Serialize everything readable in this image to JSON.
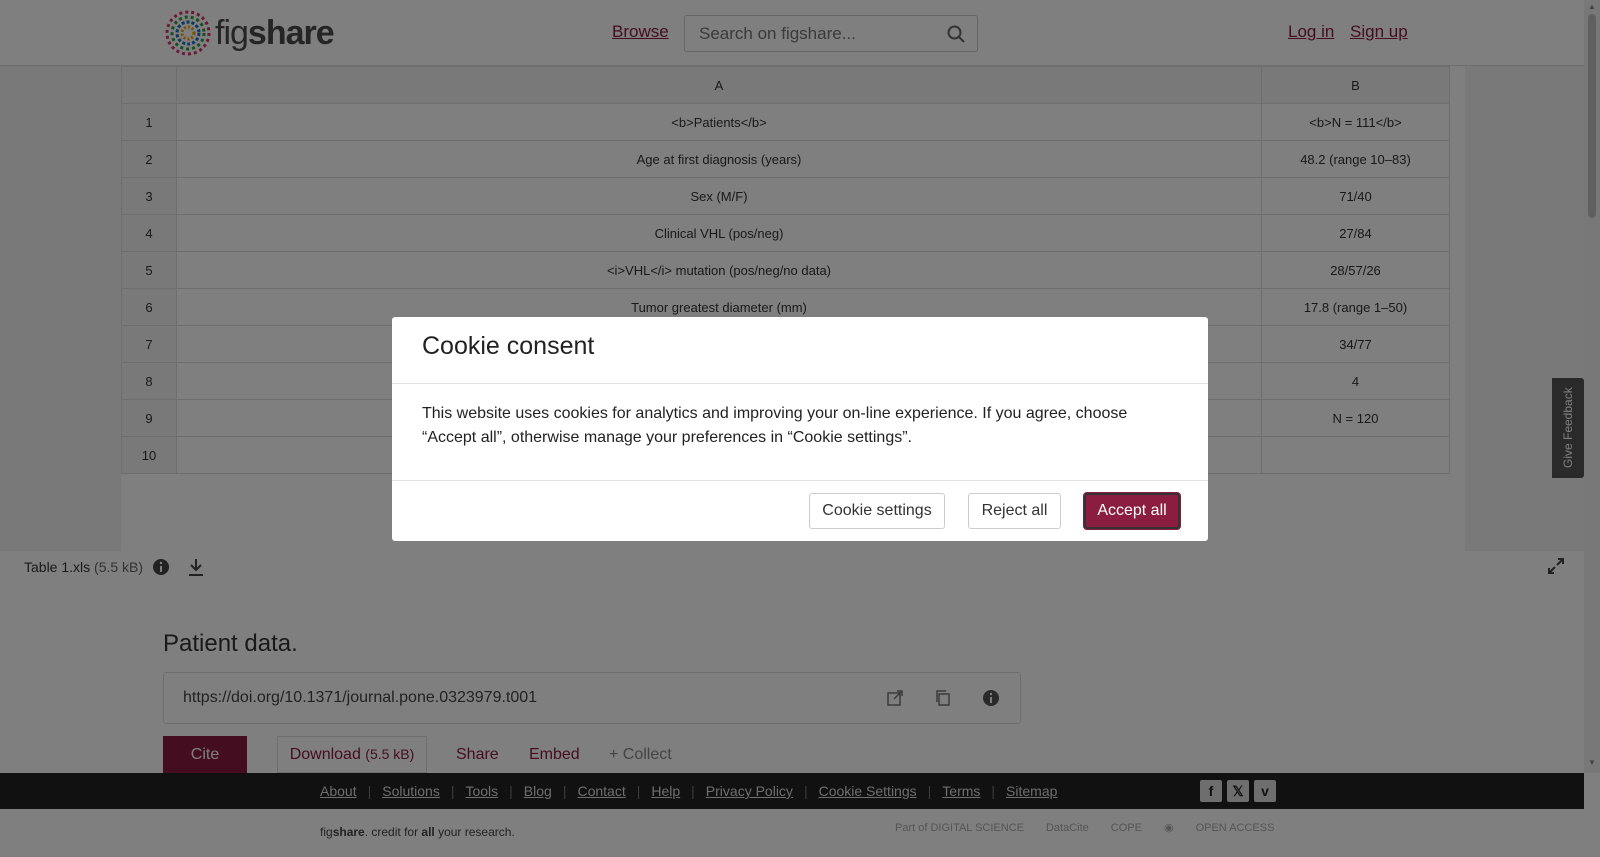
{
  "header": {
    "logo_text_light": "fig",
    "logo_text_bold": "share",
    "browse_label": "Browse",
    "search_placeholder": "Search on figshare...",
    "login_label": "Log in",
    "signup_label": "Sign up"
  },
  "sheet": {
    "columns": [
      "A",
      "B"
    ],
    "rows": [
      {
        "num": "1",
        "a": "<b>Patients</b>",
        "b": "<b>N = 111</b>"
      },
      {
        "num": "2",
        "a": "Age at first diagnosis (years)",
        "b": "48.2 (range 10–83)"
      },
      {
        "num": "3",
        "a": "Sex (M/F)",
        "b": "71/40"
      },
      {
        "num": "4",
        "a": "Clinical VHL (pos/neg)",
        "b": "27/84"
      },
      {
        "num": "5",
        "a": "<i>VHL</i> mutation (pos/neg/no data)",
        "b": "28/57/26"
      },
      {
        "num": "6",
        "a": "Tumor greatest diameter (mm)",
        "b": "17.8 (range 1–50)"
      },
      {
        "num": "7",
        "a": "",
        "b": "34/77"
      },
      {
        "num": "8",
        "a": "",
        "b": "4"
      },
      {
        "num": "9",
        "a": "",
        "b": "N = 120"
      },
      {
        "num": "10",
        "a": "",
        "b": ""
      }
    ]
  },
  "filebar": {
    "filename": "Table 1.xls",
    "filesize": "(5.5 kB)"
  },
  "item": {
    "title": "Patient data.",
    "doi": "https://doi.org/10.1371/journal.pone.0323979.t001",
    "cite_label": "Cite",
    "download_label": "Download",
    "download_size": "(5.5 kB)",
    "share_label": "Share",
    "embed_label": "Embed",
    "collect_label": "+ Collect"
  },
  "footer": {
    "links": [
      "About",
      "Solutions",
      "Tools",
      "Blog",
      "Contact",
      "Help",
      "Privacy Policy",
      "Cookie Settings",
      "Terms",
      "Sitemap"
    ],
    "tagline_light": "fig",
    "tagline_bold": "share",
    "tagline_mid": ". credit for ",
    "tagline_all": "all",
    "tagline_end": " your research.",
    "partner_digital": "Part of DIGITAL SCIENCE",
    "partner_datacite": "DataCite",
    "partner_cope": "COPE",
    "partner_open": "OPEN ACCESS"
  },
  "feedback_label": "Give Feedback",
  "modal": {
    "title": "Cookie consent",
    "body": "This website uses cookies for analytics and improving your on-line experience. If you agree, choose “Accept all”, otherwise manage your preferences in “Cookie settings”.",
    "settings_label": "Cookie settings",
    "reject_label": "Reject all",
    "accept_label": "Accept all"
  },
  "colors": {
    "brand": "#8b1d41",
    "footer_bg": "#222222"
  }
}
